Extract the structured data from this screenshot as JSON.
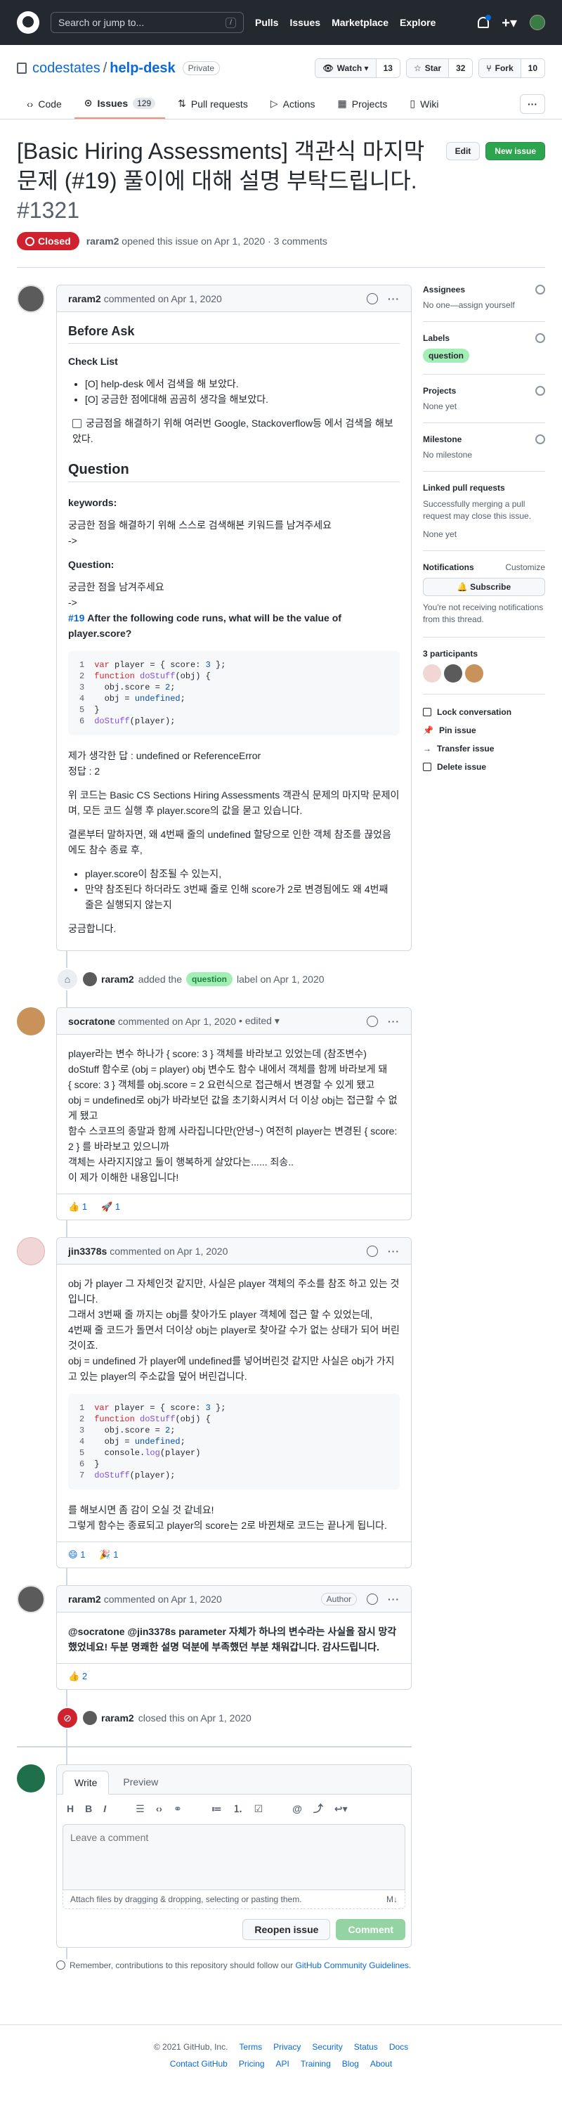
{
  "header": {
    "search_placeholder": "Search or jump to...",
    "search_kbd": "/",
    "nav": [
      "Pulls",
      "Issues",
      "Marketplace",
      "Explore"
    ],
    "plus": "+▾"
  },
  "repo": {
    "owner": "codestates",
    "sep": "/",
    "name": "help-desk",
    "visibility": "Private",
    "watch_label": "Watch ▾",
    "watch_count": "13",
    "star_label": "Star",
    "star_count": "32",
    "fork_label": "Fork",
    "fork_count": "10"
  },
  "tabs": [
    {
      "label": "Code",
      "icon": "code-icon"
    },
    {
      "label": "Issues",
      "count": "129",
      "icon": "issue-icon"
    },
    {
      "label": "Pull requests",
      "icon": "pull-request-icon"
    },
    {
      "label": "Actions",
      "icon": "actions-icon"
    },
    {
      "label": "Projects",
      "icon": "projects-icon"
    },
    {
      "label": "Wiki",
      "icon": "wiki-icon"
    }
  ],
  "issue": {
    "title": "[Basic Hiring Assessments] 객관식 마지막 문제 (#19) 풀이에 대해 설명 부탁드립니다.",
    "number": "#1321",
    "edit_label": "Edit",
    "new_issue_label": "New issue",
    "state": "Closed",
    "author": "raram2",
    "meta": "opened this issue on Apr 1, 2020 · 3 comments"
  },
  "comments": [
    {
      "author": "raram2",
      "meta": "commented on Apr 1, 2020",
      "body": {
        "h_before": "Before Ask",
        "h_checklist": "Check List",
        "checklist": [
          "[O] help-desk 에서 검색을 해 보았다.",
          "[O] 궁금한 점에대해 곰곰히 생각을 해보았다."
        ],
        "task_item": "궁금점을 해결하기 위해 여러번 Google, Stackoverflow등 에서 검색을 해보았다.",
        "h_question": "Question",
        "h_keywords": "keywords:",
        "kw_text1": "궁금한 점을 해결하기 위해 스스로 검색해본 키워드를 남겨주세요",
        "kw_text2": "->",
        "h_question2": "Question:",
        "q_text1": "궁금한 점을 남겨주세요",
        "q_text2": "->",
        "q_link": "#19",
        "q_bold": "After the following code runs, what will be the value of player.score?",
        "code": [
          {
            "n": "1",
            "t": "var player = { score: 3 };"
          },
          {
            "n": "2",
            "t": "function doStuff(obj) {"
          },
          {
            "n": "3",
            "t": "  obj.score = 2;"
          },
          {
            "n": "4",
            "t": "  obj = undefined;"
          },
          {
            "n": "5",
            "t": "}"
          },
          {
            "n": "6",
            "t": "doStuff(player);"
          }
        ],
        "answer1": "제가 생각한 답 : undefined or ReferenceError",
        "answer2": "정답 : 2",
        "para1": "위 코드는 Basic CS Sections Hiring Assessments 객관식 문제의 마지막 문제이며, 모든 코드 실행 후 player.score의 값을 묻고 있습니다.",
        "para2": "결론부터 말하자면, 왜 4번째 줄의 undefined 할당으로 인한 객체 참조를 끊었음에도 참수 종료 후,",
        "bullets": [
          "player.score이 참조될 수 있는지,",
          "만약 참조된다 하더라도 3번째 줄로 인해 score가 2로 변경됨에도 왜 4번째 줄은 실행되지 않는지"
        ],
        "closing": "궁금합니다."
      }
    },
    {
      "author": "socratone",
      "meta": "commented on Apr 1, 2020",
      "edited": "• edited ▾",
      "lines": [
        "player라는 변수 하나가 { score: 3 } 객체를 바라보고 있었는데 (참조변수)",
        "doStuff 함수로 (obj = player) obj 변수도 함수 내에서 객체를 함께 바라보게 돼",
        "{ score: 3 } 객체를 obj.score = 2 요런식으로 접근해서 변경할 수 있게 됐고",
        "obj = undefined로 obj가 바라보던 값을 초기화시켜서 더 이상 obj는 접근할 수 없게 됐고",
        "함수 스코프의 종말과 함께 사라집니다만(안녕~) 여전히 player는 변경된 { score: 2 } 를 바라보고 있으니까",
        "객체는 사라지지않고 둘이 행복하게 살았다는...... 죄송..",
        "이 제가 이해한 내용입니다!"
      ],
      "reactions": [
        {
          "emoji": "👍",
          "count": "1"
        },
        {
          "emoji": "🚀",
          "count": "1"
        }
      ]
    },
    {
      "author": "jin3378s",
      "meta": "commented on Apr 1, 2020",
      "lines": [
        "obj 가 player 그 자체인것 같지만, 사실은 player 객체의 주소를 참조 하고 있는 것 입니다.",
        "그래서 3번째 줄 까지는 obj를 찾아가도 player 객체에 접근 할 수 있었는데,",
        "4번째 줄 코드가 돌면서 더이상 obj는 player로 찾아갈 수가 없는 상태가 되어 버린 것이죠.",
        "obj = undefined 가 player에 undefined를 넣어버린것 같지만 사실은 obj가 가지고 있는 player의 주소값을 덮어 버린겁니다."
      ],
      "code": [
        {
          "n": "1",
          "t": "var player = { score: 3 };"
        },
        {
          "n": "2",
          "t": "function doStuff(obj) {"
        },
        {
          "n": "3",
          "t": "  obj.score = 2;"
        },
        {
          "n": "4",
          "t": "  obj = undefined;"
        },
        {
          "n": "5",
          "t": "  console.log(player)"
        },
        {
          "n": "6",
          "t": "}"
        },
        {
          "n": "7",
          "t": "doStuff(player);"
        }
      ],
      "after": [
        "를 해보시면 좀 감이 오실 것 같네요!",
        "그렇게 함수는 종료되고 player의 score는 2로 바뀐채로 코드는 끝나게 됩니다."
      ],
      "reactions": [
        {
          "emoji": "😄",
          "count": "1"
        },
        {
          "emoji": "🎉",
          "count": "1"
        }
      ]
    },
    {
      "author": "raram2",
      "meta": "commented on Apr 1, 2020",
      "badge": "Author",
      "text": "@socratone @jin3378s parameter 자체가 하나의 변수라는 사실을 잠시 망각했었네요! 두분 명쾌한 설명 덕분에 부족했던 부분 채워갑니다. 감사드립니다.",
      "reactions": [
        {
          "emoji": "👍",
          "count": "2"
        }
      ]
    }
  ],
  "events": {
    "labeled_actor": "raram2",
    "labeled_pre": "added the",
    "labeled_label": "question",
    "labeled_post": "label on Apr 1, 2020",
    "closed_actor": "raram2",
    "closed_text": "closed this on Apr 1, 2020"
  },
  "composer": {
    "tab_write": "Write",
    "tab_preview": "Preview",
    "placeholder": "Leave a comment",
    "attach": "Attach files by dragging & dropping, selecting or pasting them.",
    "md_badge": "M↓",
    "reopen": "Reopen issue",
    "submit": "Comment",
    "remember_pre": "Remember, contributions to this repository should follow our",
    "remember_link": "GitHub Community Guidelines",
    "remember_post": "."
  },
  "sidebar": {
    "assignees_h": "Assignees",
    "assignees_v": "No one—assign yourself",
    "labels_h": "Labels",
    "label": "question",
    "projects_h": "Projects",
    "projects_v": "None yet",
    "milestone_h": "Milestone",
    "milestone_v": "No milestone",
    "linked_h": "Linked pull requests",
    "linked_desc": "Successfully merging a pull request may close this issue.",
    "linked_v": "None yet",
    "notif_h": "Notifications",
    "customize": "Customize",
    "subscribe": "🔔 Subscribe",
    "notif_desc": "You're not receiving notifications from this thread.",
    "participants": "3 participants",
    "lock": "Lock conversation",
    "pin": "Pin issue",
    "transfer": "Transfer issue",
    "delete": "Delete issue"
  },
  "footer": {
    "copyright": "© 2021 GitHub, Inc.",
    "row1": [
      "Terms",
      "Privacy",
      "Security",
      "Status",
      "Docs"
    ],
    "row2": [
      "Contact GitHub",
      "Pricing",
      "API",
      "Training",
      "Blog",
      "About"
    ]
  }
}
